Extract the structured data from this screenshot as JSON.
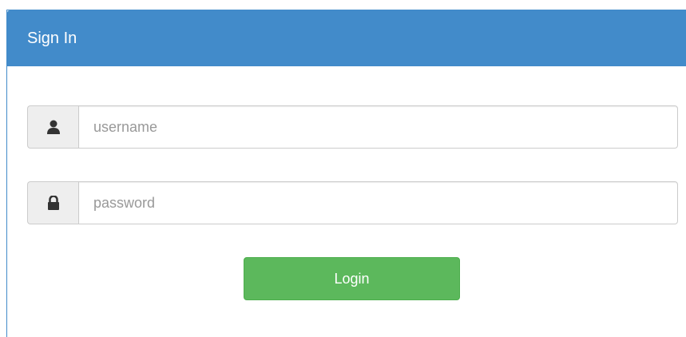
{
  "panel": {
    "title": "Sign In",
    "accent_color": "#428bca"
  },
  "form": {
    "username": {
      "icon": "user-icon",
      "value": "",
      "placeholder": "username"
    },
    "password": {
      "icon": "lock-icon",
      "value": "",
      "placeholder": "password"
    },
    "login_label": "Login",
    "login_color": "#5cb85c"
  }
}
